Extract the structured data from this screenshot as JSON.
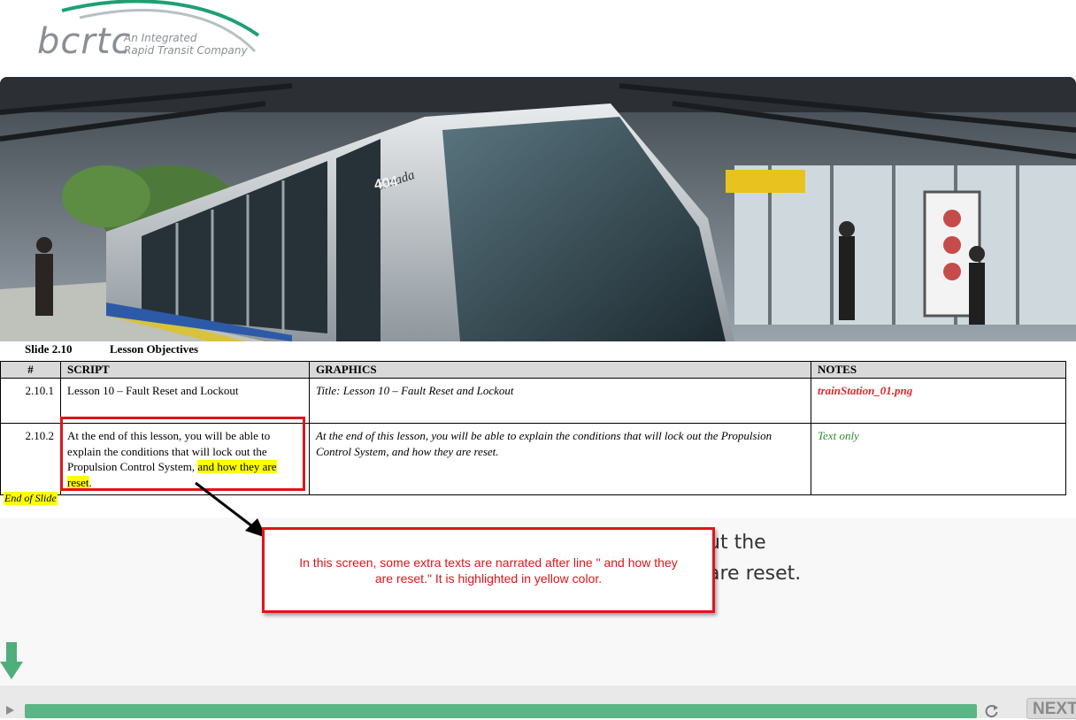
{
  "logo": {
    "word": "bcrtc",
    "tagline_1": "An Integrated",
    "tagline_2": "Rapid Transit Company"
  },
  "hero": {
    "train_number": "404",
    "train_brand": "Canada"
  },
  "slide": {
    "number": "Slide 2.10",
    "title": "Lesson Objectives"
  },
  "table": {
    "headers": [
      "#",
      "SCRIPT",
      "GRAPHICS",
      "NOTES"
    ],
    "rows": [
      {
        "num": "2.10.1",
        "script": "Lesson 10 – Fault Reset and Lockout",
        "graphics": "Title: Lesson 10 – Fault Reset and Lockout",
        "notes": "trainStation_01.png"
      },
      {
        "num": "2.10.2",
        "script_main": "At the end of this lesson, you will be able to explain the conditions that will lock out the Propulsion Control System,",
        "script_highlight": "and how they are reset",
        "script_end": ".",
        "graphics": "At the end of this lesson, you will be able to explain the conditions that will lock out the Propulsion Control System, and how they are reset.",
        "notes": "Text only"
      }
    ]
  },
  "end_of_slide": "End of Slide",
  "background_text": {
    "line1": "ut the",
    "line2": "are reset."
  },
  "callout": {
    "text": "In this screen, some extra texts are narrated after line \" and how they are reset.\" It is highlighted in yellow color."
  },
  "player": {
    "next_label": "NEXT",
    "progress": 1.0
  },
  "colors": {
    "progress": "#5cb584",
    "callout_border": "#e0141a",
    "highlight": "#ffff00",
    "note_red": "#e0282b",
    "note_green": "#2f8a2f"
  },
  "icons": [
    "play-icon",
    "reload-icon",
    "down-arrow-icon"
  ]
}
